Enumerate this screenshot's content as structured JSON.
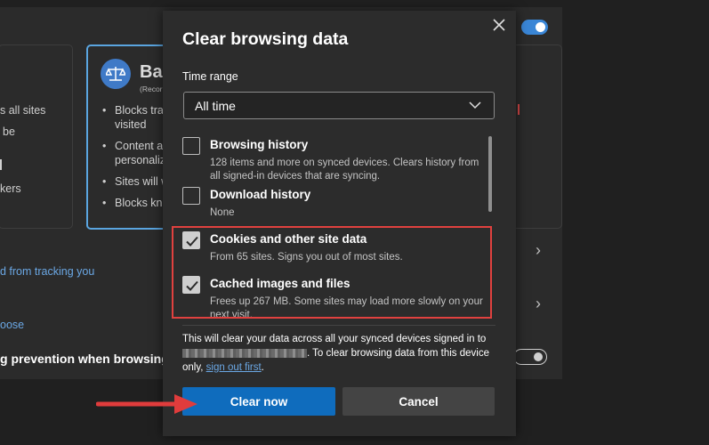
{
  "background": {
    "card_left_lines": [
      "s all sites",
      "be",
      "kers"
    ],
    "balanced_title": "Bal",
    "balanced_subtitle": "(Recor",
    "balanced_bullets": [
      "Blocks trac",
      "visited",
      "Content ar",
      "personaliz",
      "Sites will w",
      "Blocks kno"
    ],
    "tracking_link": "d from tracking you",
    "choose_link": "oose",
    "prevention_text": "g prevention when browsing I"
  },
  "dialog": {
    "title": "Clear browsing data",
    "close_label": "×",
    "time_range": {
      "label": "Time range",
      "value": "All time"
    },
    "items": [
      {
        "title": "Browsing history",
        "description": "128 items and more on synced devices. Clears history from all signed-in devices that are syncing.",
        "checked": false
      },
      {
        "title": "Download history",
        "description": "None",
        "checked": false
      },
      {
        "title": "Cookies and other site data",
        "description": "From 65 sites. Signs you out of most sites.",
        "checked": true
      },
      {
        "title": "Cached images and files",
        "description": "Frees up 267 MB. Some sites may load more slowly on your next visit.",
        "checked": true
      }
    ],
    "note": {
      "part1": "This will clear your data across all your synced devices signed in to",
      "part2": ". To clear browsing data from this device only,",
      "link": "sign out first",
      "part3": "."
    },
    "buttons": {
      "primary": "Clear now",
      "secondary": "Cancel"
    }
  },
  "colors": {
    "accent": "#0f6cbd",
    "highlight": "#e0413f",
    "arrow": "#e03c3c",
    "dialog_bg": "#2c2c2c",
    "page_bg": "#202020"
  }
}
